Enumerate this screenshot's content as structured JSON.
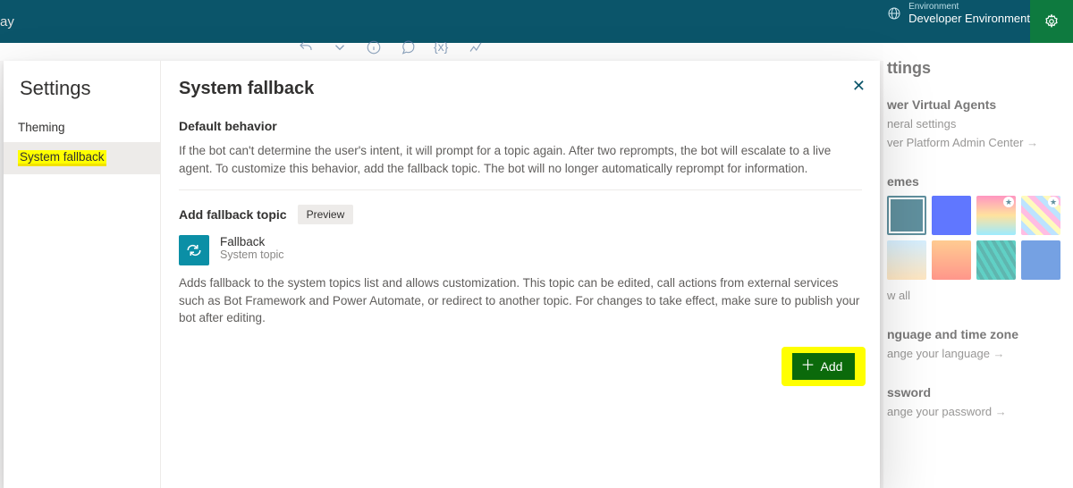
{
  "header": {
    "app_fragment": "ay",
    "env_label": "Environment",
    "env_value": "Developer Environment"
  },
  "right_panel": {
    "title_fragment": "ttings",
    "section1": "wer Virtual Agents",
    "link1": "neral settings",
    "link2": "ver Platform Admin Center",
    "section2": "emes",
    "show_all": "w all",
    "section3": "nguage and time zone",
    "link3": "ange your language",
    "section4": "ssword",
    "link4": "ange your password"
  },
  "modal": {
    "nav_title": "Settings",
    "nav_items": [
      "Theming",
      "System fallback"
    ],
    "active_index": 1,
    "content": {
      "title": "System fallback",
      "h2a": "Default behavior",
      "para_a": "If the bot can't determine the user's intent, it will prompt for a topic again. After two reprompts, the bot will escalate to a live agent. To customize this behavior, add the fallback topic. The bot will no longer automatically reprompt for information.",
      "h2b": "Add fallback topic",
      "preview_badge": "Preview",
      "topic_name": "Fallback",
      "topic_sub": "System topic",
      "para_b": "Adds fallback to the system topics list and allows customization. This topic can be edited, call actions from external services such as Bot Framework and Power Automate, or redirect to another topic. For changes to take effect, make sure to publish your bot after editing.",
      "add_label": "Add"
    }
  },
  "toolbar": {
    "var_glyph": "{x}"
  }
}
